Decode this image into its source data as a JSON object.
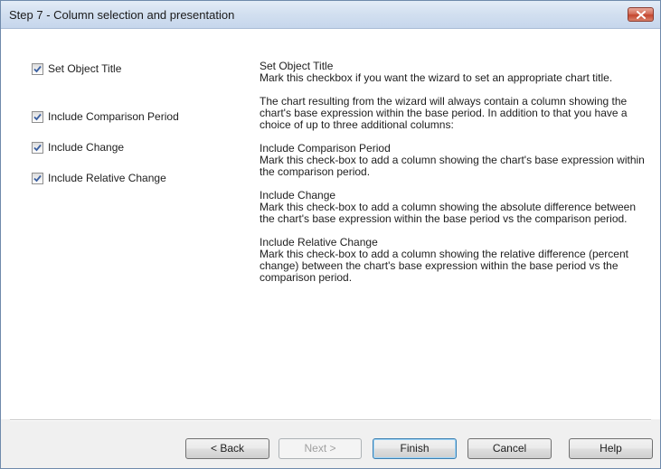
{
  "window": {
    "title": "Step 7 - Column selection and presentation"
  },
  "options": [
    {
      "label": "Set Object Title",
      "checked": true
    },
    {
      "label": "Include Comparison Period",
      "checked": true
    },
    {
      "label": "Include Change",
      "checked": true
    },
    {
      "label": "Include Relative Change",
      "checked": true
    }
  ],
  "help": {
    "paragraphs": [
      [
        "Set Object Title",
        "Mark this checkbox if you want the wizard to set an appropriate chart title."
      ],
      [
        "The chart resulting from the wizard will always contain a column showing the chart's base expression within the base period. In addition to that you have a choice of up to three additional columns:"
      ],
      [
        "Include Comparison Period",
        "Mark this check-box to add a column showing the chart's base expression within the comparison period."
      ],
      [
        "Include Change",
        "Mark this check-box to add a column showing the absolute difference between the chart's base expression within the base period vs the comparison period."
      ],
      [
        "Include Relative Change",
        "Mark this check-box to add a column showing the relative difference (percent change) between the chart's base expression within the base period vs the comparison period."
      ]
    ]
  },
  "buttons": {
    "back": "< Back",
    "next": "Next >",
    "finish": "Finish",
    "cancel": "Cancel",
    "help": "Help"
  },
  "colors": {
    "title_bar": "#d3e0f0",
    "close_button": "#c4452e",
    "default_button_border": "#3c7fb1"
  }
}
